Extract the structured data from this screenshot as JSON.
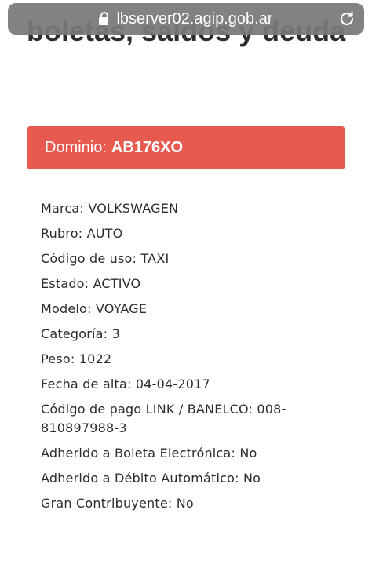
{
  "browser": {
    "url": "lbserver02.agip.gob.ar"
  },
  "page": {
    "title": "boletas, saldos y deuda",
    "dominio_label": "Dominio:",
    "dominio_value": "AB176XO"
  },
  "details": [
    {
      "label": "Marca:",
      "value": "VOLKSWAGEN"
    },
    {
      "label": "Rubro:",
      "value": "AUTO"
    },
    {
      "label": "Código de uso:",
      "value": "TAXI"
    },
    {
      "label": "Estado:",
      "value": "ACTIVO"
    },
    {
      "label": "Modelo:",
      "value": "VOYAGE"
    },
    {
      "label": "Categoría:",
      "value": "3"
    },
    {
      "label": "Peso:",
      "value": "1022"
    },
    {
      "label": "Fecha de alta:",
      "value": "04-04-2017"
    },
    {
      "label": "Código de pago LINK / BANELCO:",
      "value": "008-810897988-3"
    },
    {
      "label": "Adherido a Boleta Electrónica:",
      "value": "No"
    },
    {
      "label": "Adherido a Débito Automático:",
      "value": "No"
    },
    {
      "label": "Gran Contribuyente:",
      "value": "No"
    }
  ],
  "colors": {
    "accent": "#e75a50",
    "urlbar": "#787878"
  },
  "icons": {
    "lock": "lock-icon",
    "reload": "reload-icon"
  }
}
